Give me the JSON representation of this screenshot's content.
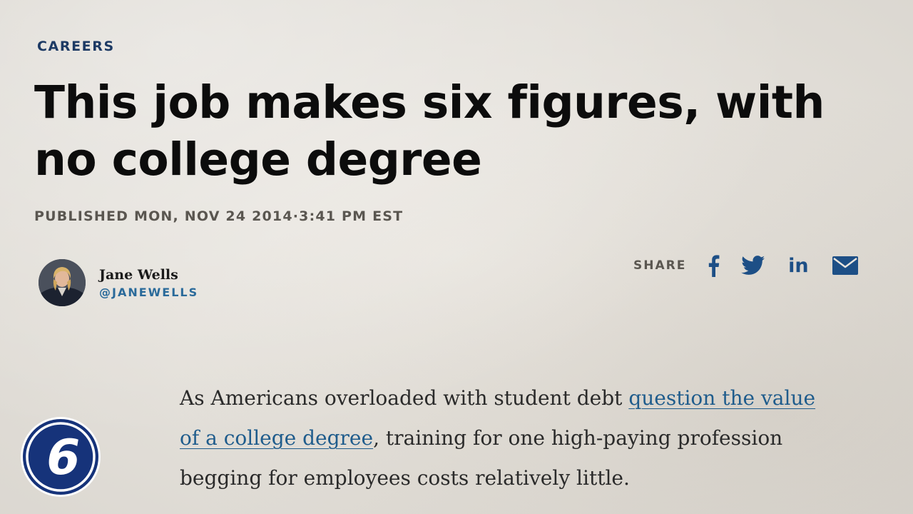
{
  "article": {
    "section": "CAREERS",
    "headline": "This job makes six figures, with no college degree",
    "published": "PUBLISHED MON, NOV 24 2014·3:41 PM EST"
  },
  "author": {
    "name": "Jane Wells",
    "handle": "@JANEWELLS"
  },
  "share": {
    "label": "SHARE",
    "icons": [
      "facebook-icon",
      "twitter-icon",
      "linkedin-icon",
      "email-icon"
    ],
    "linkedin_text": "in",
    "color": "#1d4f86"
  },
  "body": {
    "before_link": "As Americans overloaded with student debt ",
    "link_text": "question the value of a college degree",
    "after_link": ", training for one high-paying profession begging for employees costs relatively little."
  },
  "badge": {
    "number": "6",
    "color": "#16337a"
  }
}
